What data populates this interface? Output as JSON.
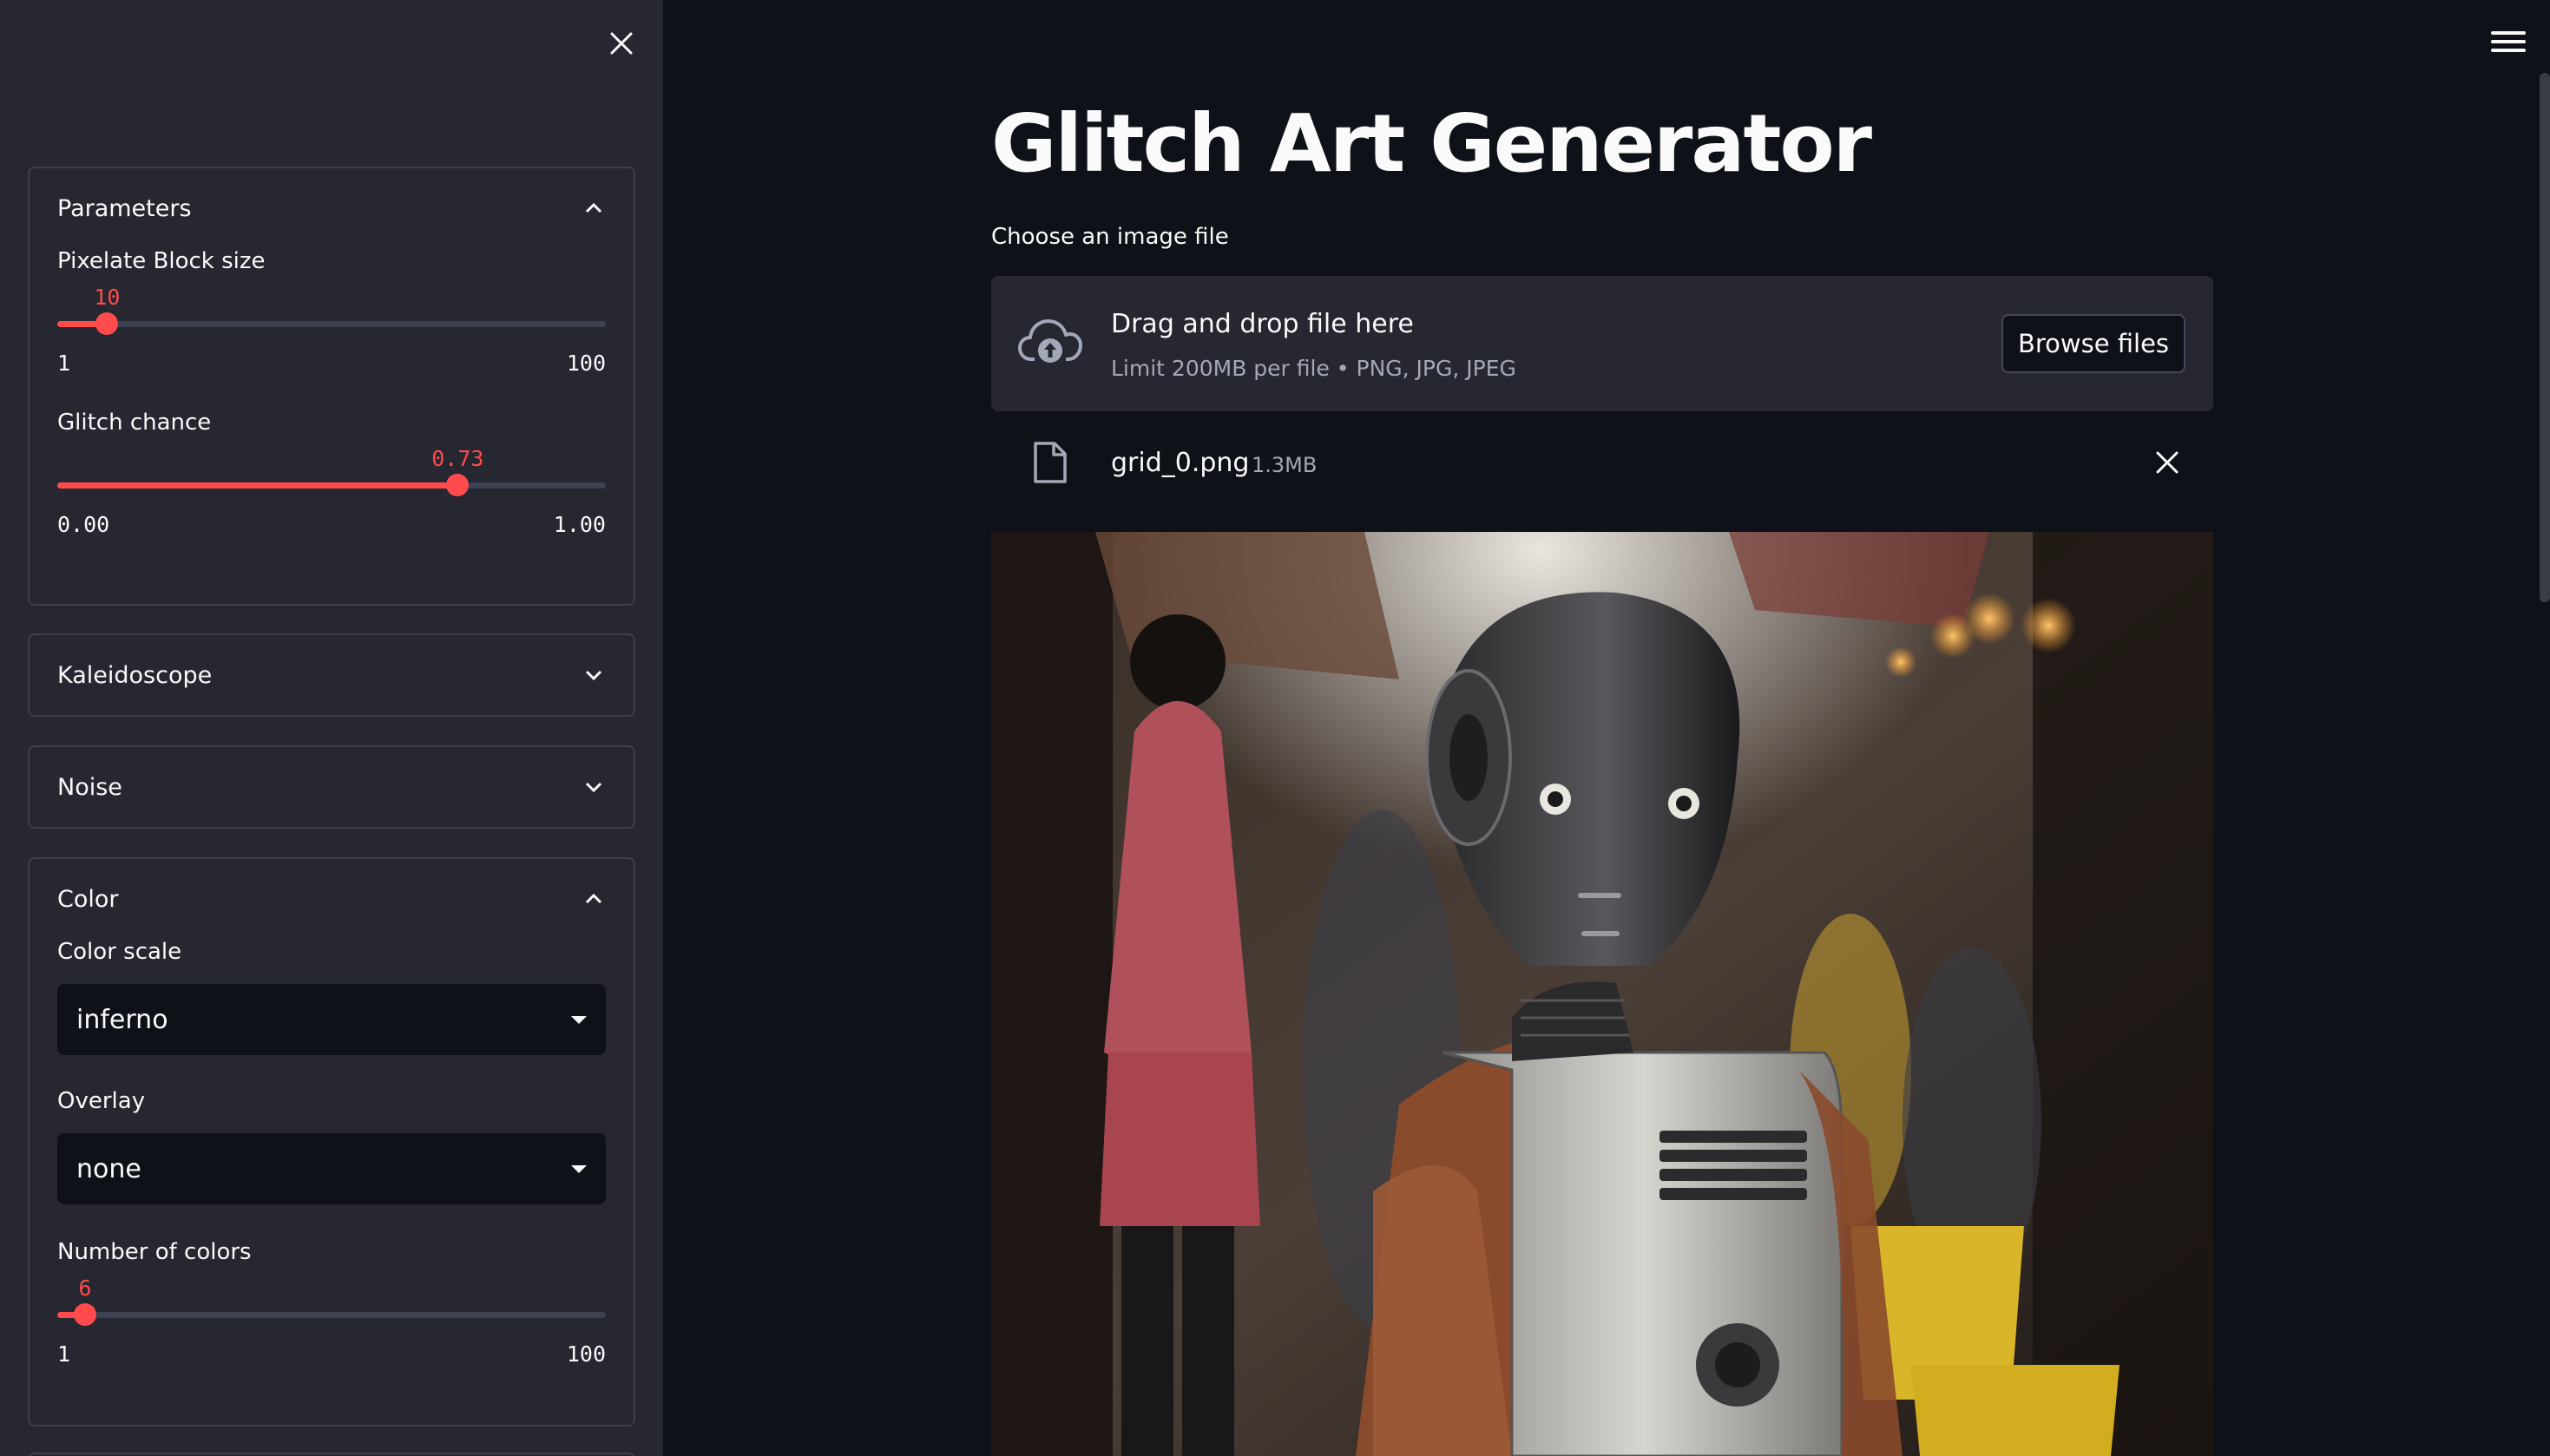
{
  "sidebar": {
    "parameters": {
      "title": "Parameters",
      "pixelate": {
        "label": "Pixelate Block size",
        "value": "10",
        "min": "1",
        "max": "100",
        "fraction": 0.0909
      },
      "glitch": {
        "label": "Glitch chance",
        "value": "0.73",
        "min": "0.00",
        "max": "1.00",
        "fraction": 0.73
      }
    },
    "kaleidoscope": {
      "title": "Kaleidoscope"
    },
    "noise": {
      "title": "Noise"
    },
    "color": {
      "title": "Color",
      "scale": {
        "label": "Color scale",
        "value": "inferno"
      },
      "overlay": {
        "label": "Overlay",
        "value": "none"
      },
      "num_colors": {
        "label": "Number of colors",
        "value": "6",
        "min": "1",
        "max": "100",
        "fraction": 0.0505
      }
    }
  },
  "main": {
    "title": "Glitch Art Generator",
    "uploader": {
      "label": "Choose an image file",
      "drop_text": "Drag and drop file here",
      "limit_text": "Limit 200MB per file • PNG, JPG, JPEG",
      "browse_label": "Browse files"
    },
    "file": {
      "name": "grid_0.png",
      "size": "1.3MB"
    }
  },
  "colors": {
    "accent": "#ff4b4b",
    "sidebar_bg": "#262730",
    "main_bg": "#0e1117"
  }
}
